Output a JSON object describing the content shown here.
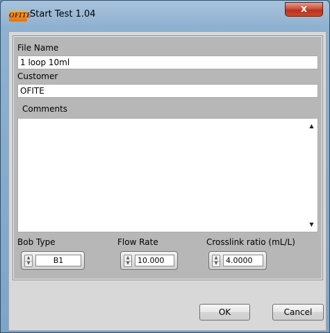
{
  "window": {
    "title": "Start Test  1.04",
    "logo_text": "OFITE",
    "close_symbol": "x"
  },
  "form": {
    "file_name": {
      "label": "File Name",
      "value": "1 loop 10ml"
    },
    "customer": {
      "label": "Customer",
      "value": "OFITE"
    },
    "comments": {
      "label": "Comments",
      "value": ""
    },
    "bob_type": {
      "label": "Bob Type",
      "value": "B1"
    },
    "flow_rate": {
      "label": "Flow Rate",
      "value": "10.000"
    },
    "crosslink_ratio": {
      "label": "Crosslink ratio (mL/L)",
      "value": "4.0000"
    }
  },
  "buttons": {
    "ok": "OK",
    "cancel": "Cancel"
  },
  "icons": {
    "scroll_up": "triangle-up-icon",
    "scroll_down": "triangle-down-icon",
    "spinner": "spin-updown-icon"
  }
}
